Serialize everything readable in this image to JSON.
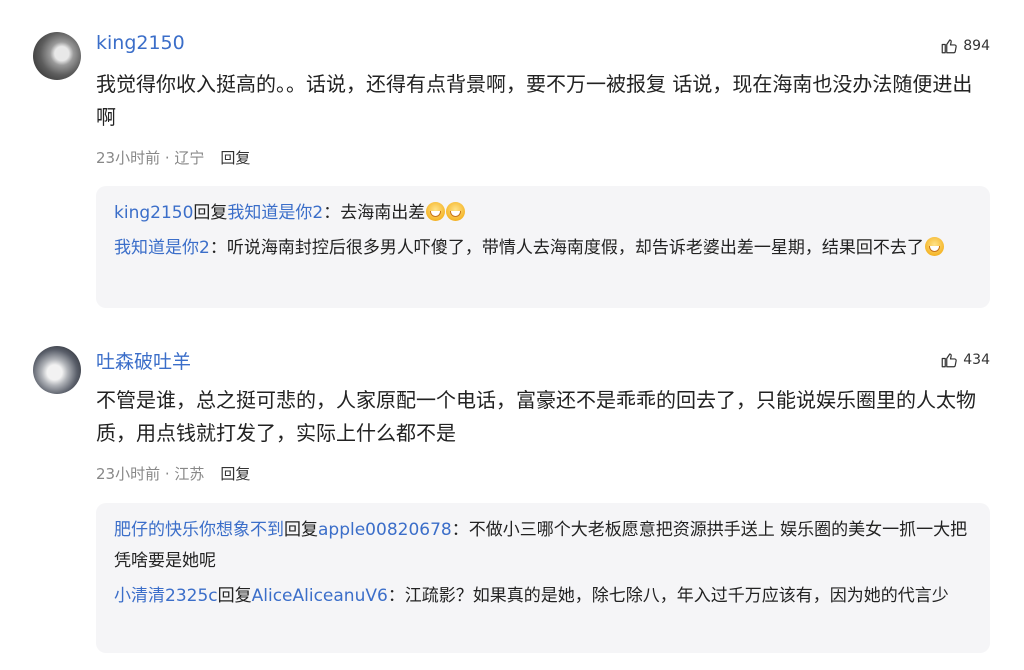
{
  "comments": [
    {
      "username": "king2150",
      "likes": "894",
      "text": "我觉得你收入挺高的。。话说，还得有点背景啊，要不万一被报复 话说，现在海南也没办法随便进出啊",
      "time": "23小时前",
      "location": "辽宁",
      "reply_label": "回复",
      "replies": [
        {
          "user": "king2150",
          "reply_word": "回复",
          "target": "我知道是你2",
          "text": "：去海南出差",
          "emoji_count": 2
        },
        {
          "user": "我知道是你2",
          "reply_word": "",
          "target": "",
          "text": "：听说海南封控后很多男人吓傻了，带情人去海南度假，却告诉老婆出差一星期，结果回不去了",
          "emoji_count": 1
        }
      ]
    },
    {
      "username": "吐森破吐羊",
      "likes": "434",
      "text": "不管是谁，总之挺可悲的，人家原配一个电话，富豪还不是乖乖的回去了，只能说娱乐圈里的人太物质，用点钱就打发了，实际上什么都不是",
      "time": "23小时前",
      "location": "江苏",
      "reply_label": "回复",
      "replies": [
        {
          "user": "肥仔的快乐你想象不到",
          "reply_word": "回复",
          "target": "apple00820678",
          "text": "：不做小三哪个大老板愿意把资源拱手送上 娱乐圈的美女一抓一大把凭啥要是她呢",
          "emoji_count": 0
        },
        {
          "user": "小清清2325c",
          "reply_word": "回复",
          "target": "AliceAliceanuV6",
          "text": "：江疏影？如果真的是她，除七除八，年入过千万应该有，因为她的代言少",
          "emoji_count": 0
        }
      ]
    }
  ],
  "colors": {
    "link": "#3b6ec9",
    "meta": "#888888",
    "reply_bg": "#f5f5f7"
  },
  "icons": {
    "like": "thumbs-up-icon"
  }
}
